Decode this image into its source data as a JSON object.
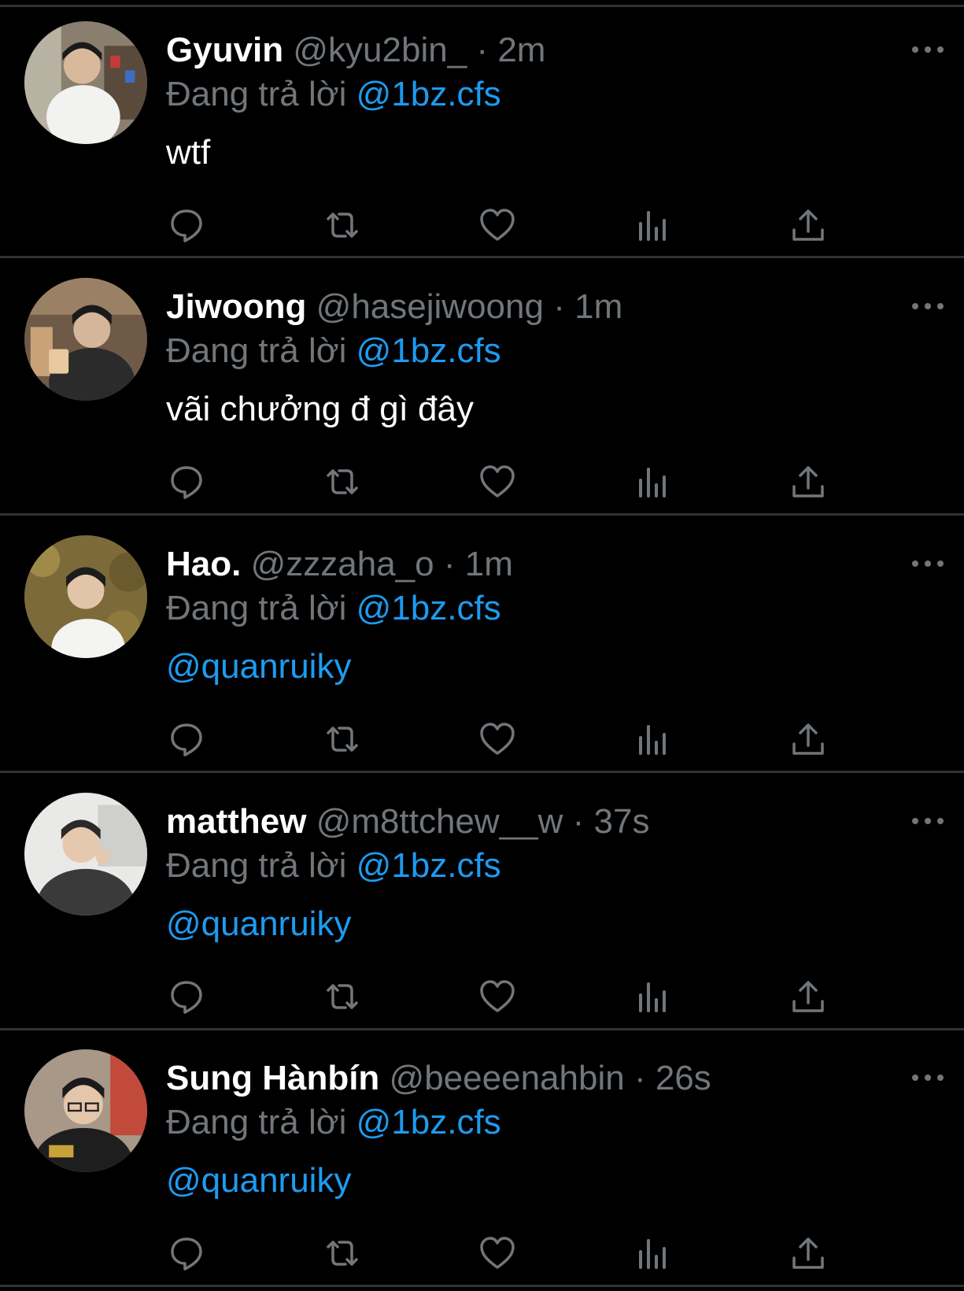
{
  "tweets": [
    {
      "name": "Gyuvin",
      "handle": "@kyu2bin_",
      "time": "2m",
      "reply_prefix": "Đang trả lời",
      "reply_to": "@1bz.cfs",
      "text": "wtf",
      "text_is_link": false
    },
    {
      "name": "Jiwoong",
      "handle": "@hasejiwoong",
      "time": "1m",
      "reply_prefix": "Đang trả lời",
      "reply_to": "@1bz.cfs",
      "text": "vãi chưởng đ gì đây",
      "text_is_link": false
    },
    {
      "name": "Hao.",
      "handle": "@zzzaha_o",
      "time": "1m",
      "reply_prefix": "Đang trả lời",
      "reply_to": "@1bz.cfs",
      "text": "@quanruiky",
      "text_is_link": true
    },
    {
      "name": "matthew",
      "handle": "@m8ttchew__w",
      "time": "37s",
      "reply_prefix": "Đang trả lời",
      "reply_to": "@1bz.cfs",
      "text": "@quanruiky",
      "text_is_link": true
    },
    {
      "name": "Sung Hànbín",
      "handle": "@beeeenahbin",
      "time": "26s",
      "reply_prefix": "Đang trả lời",
      "reply_to": "@1bz.cfs",
      "text": "@quanruiky",
      "text_is_link": true
    }
  ],
  "separator": "·",
  "icons": [
    "reply-icon",
    "retweet-icon",
    "like-icon",
    "views-icon",
    "share-icon",
    "more-icon"
  ],
  "colors": {
    "background": "#000000",
    "name": "#ffffff",
    "muted": "#71767b",
    "link": "#1d9bf0",
    "divider": "#2f3336"
  }
}
